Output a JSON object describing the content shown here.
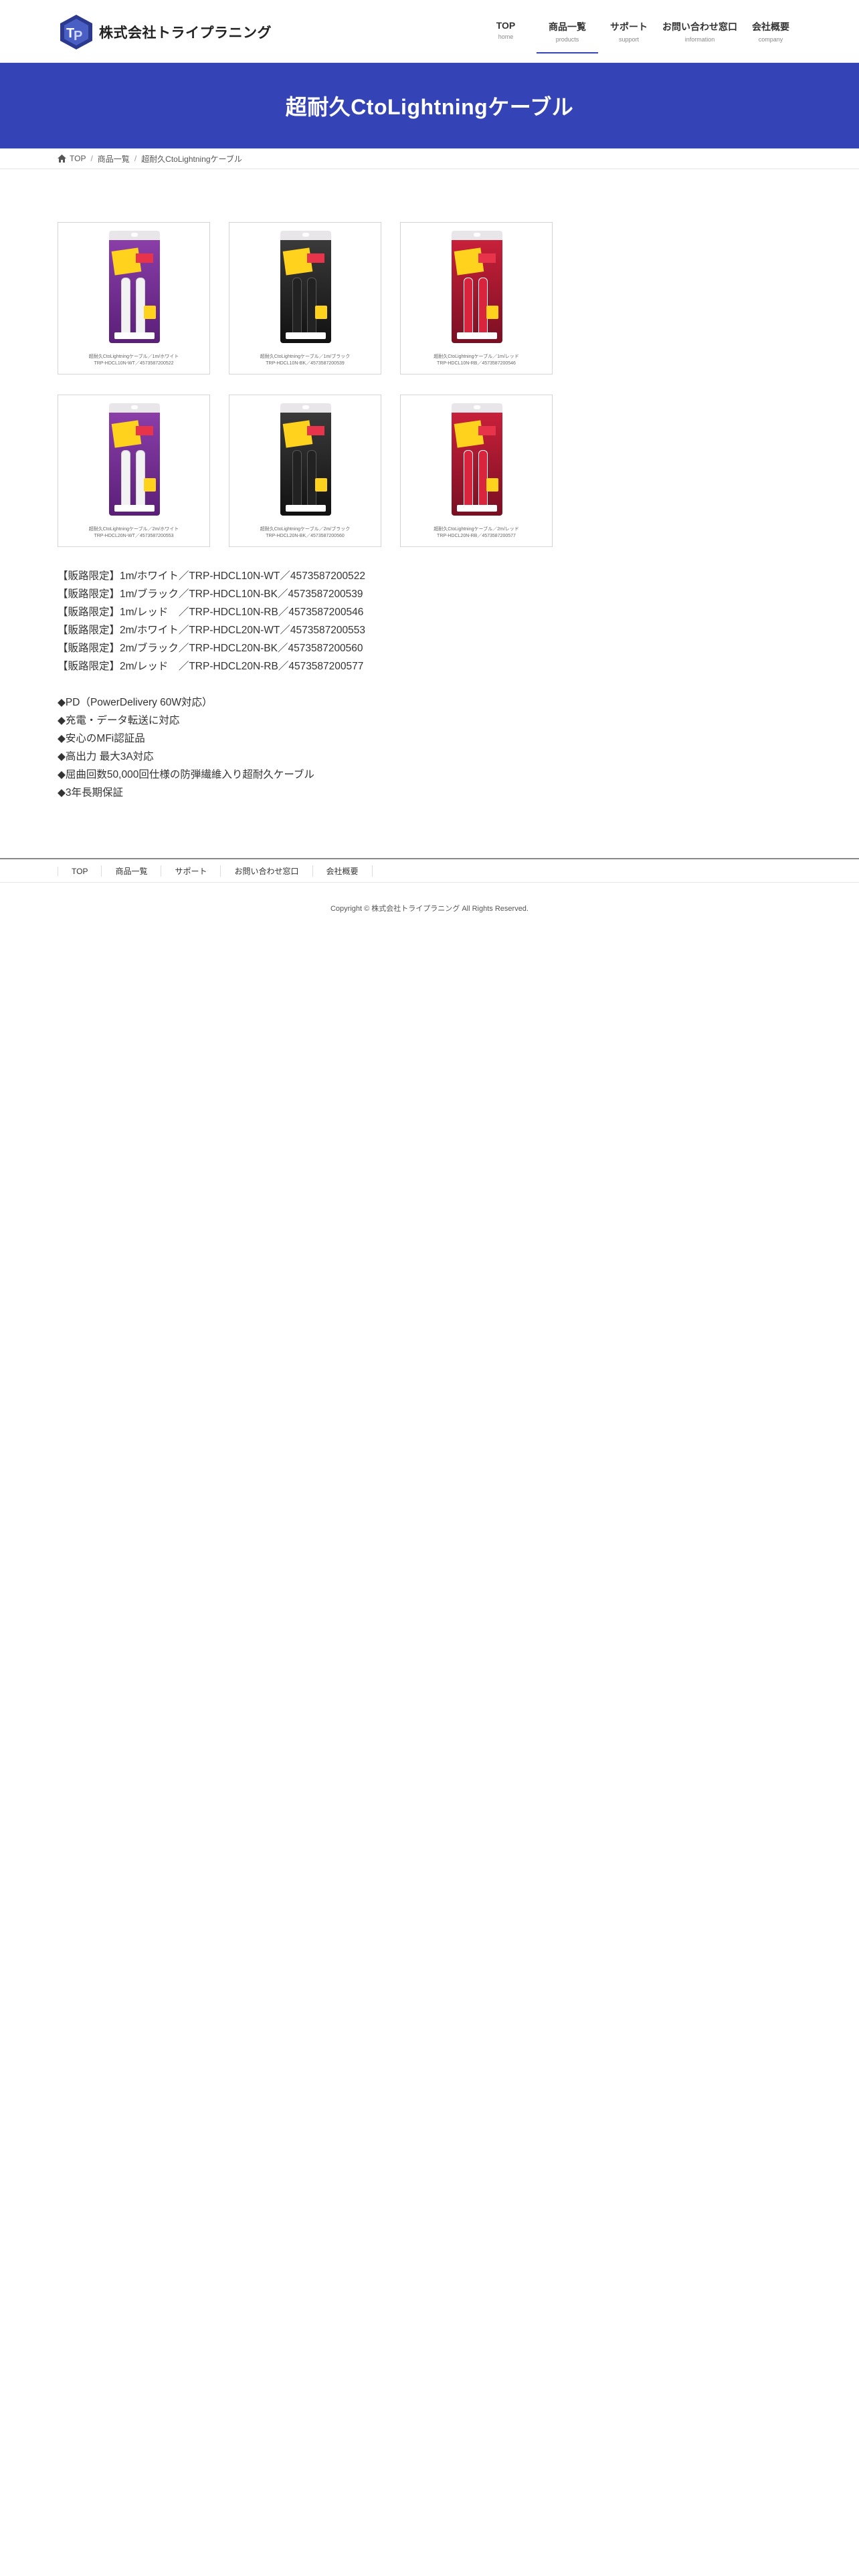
{
  "header": {
    "logo_text": "株式会社トライプラニング",
    "nav": [
      {
        "label": "TOP",
        "sub": "home"
      },
      {
        "label": "商品一覧",
        "sub": "products"
      },
      {
        "label": "サポート",
        "sub": "support"
      },
      {
        "label": "お問い合わせ窓口",
        "sub": "information"
      },
      {
        "label": "会社概要",
        "sub": "company"
      }
    ],
    "current_index": 1
  },
  "page_title": "超耐久CtoLightningケーブル",
  "breadcrumb": [
    "TOP",
    "商品一覧",
    "超耐久CtoLightningケーブル"
  ],
  "products": [
    {
      "caption1": "超耐久CtoLightningケーブル／1m/ホワイト",
      "caption2": "TRP-HDCL10N-WT／4573587200522",
      "variant": "purple",
      "cable": "white-c"
    },
    {
      "caption1": "超耐久CtoLightningケーブル／1m/ブラック",
      "caption2": "TRP-HDCL10N-BK／4573587200539",
      "variant": "black",
      "cable": "black-c"
    },
    {
      "caption1": "超耐久CtoLightningケーブル／1m/レッド",
      "caption2": "TRP-HDCL10N-RB／4573587200546",
      "variant": "red",
      "cable": "red-c"
    },
    {
      "caption1": "超耐久CtoLightningケーブル／2m/ホワイト",
      "caption2": "TRP-HDCL20N-WT／4573587200553",
      "variant": "purple",
      "cable": "white-c"
    },
    {
      "caption1": "超耐久CtoLightningケーブル／2m/ブラック",
      "caption2": "TRP-HDCL20N-BK／4573587200560",
      "variant": "black",
      "cable": "black-c"
    },
    {
      "caption1": "超耐久CtoLightningケーブル／2m/レッド",
      "caption2": "TRP-HDCL20N-RB／4573587200577",
      "variant": "red",
      "cable": "red-c"
    }
  ],
  "description": {
    "lines": [
      "【販路限定】1m/ホワイト／TRP-HDCL10N-WT／4573587200522",
      "【販路限定】1m/ブラック／TRP-HDCL10N-BK／4573587200539",
      "【販路限定】1m/レッド　／TRP-HDCL10N-RB／4573587200546",
      "【販路限定】2m/ホワイト／TRP-HDCL20N-WT／4573587200553",
      "【販路限定】2m/ブラック／TRP-HDCL20N-BK／4573587200560",
      "【販路限定】2m/レッド　／TRP-HDCL20N-RB／4573587200577"
    ],
    "features": [
      "◆PD（PowerDelivery 60W対応）",
      "◆充電・データ転送に対応",
      "◆安心のMFi認証品",
      "◆高出力 最大3A対応",
      "◆屈曲回数50,000回仕様の防弾繊維入り超耐久ケーブル",
      "◆3年長期保証"
    ]
  },
  "footer": {
    "nav": [
      "TOP",
      "商品一覧",
      "サポート",
      "お問い合わせ窓口",
      "会社概要"
    ],
    "copyright": "Copyright © 株式会社トライプラニング All Rights Reserved."
  },
  "colors": {
    "accent": "#3443b6",
    "text": "#333333"
  }
}
